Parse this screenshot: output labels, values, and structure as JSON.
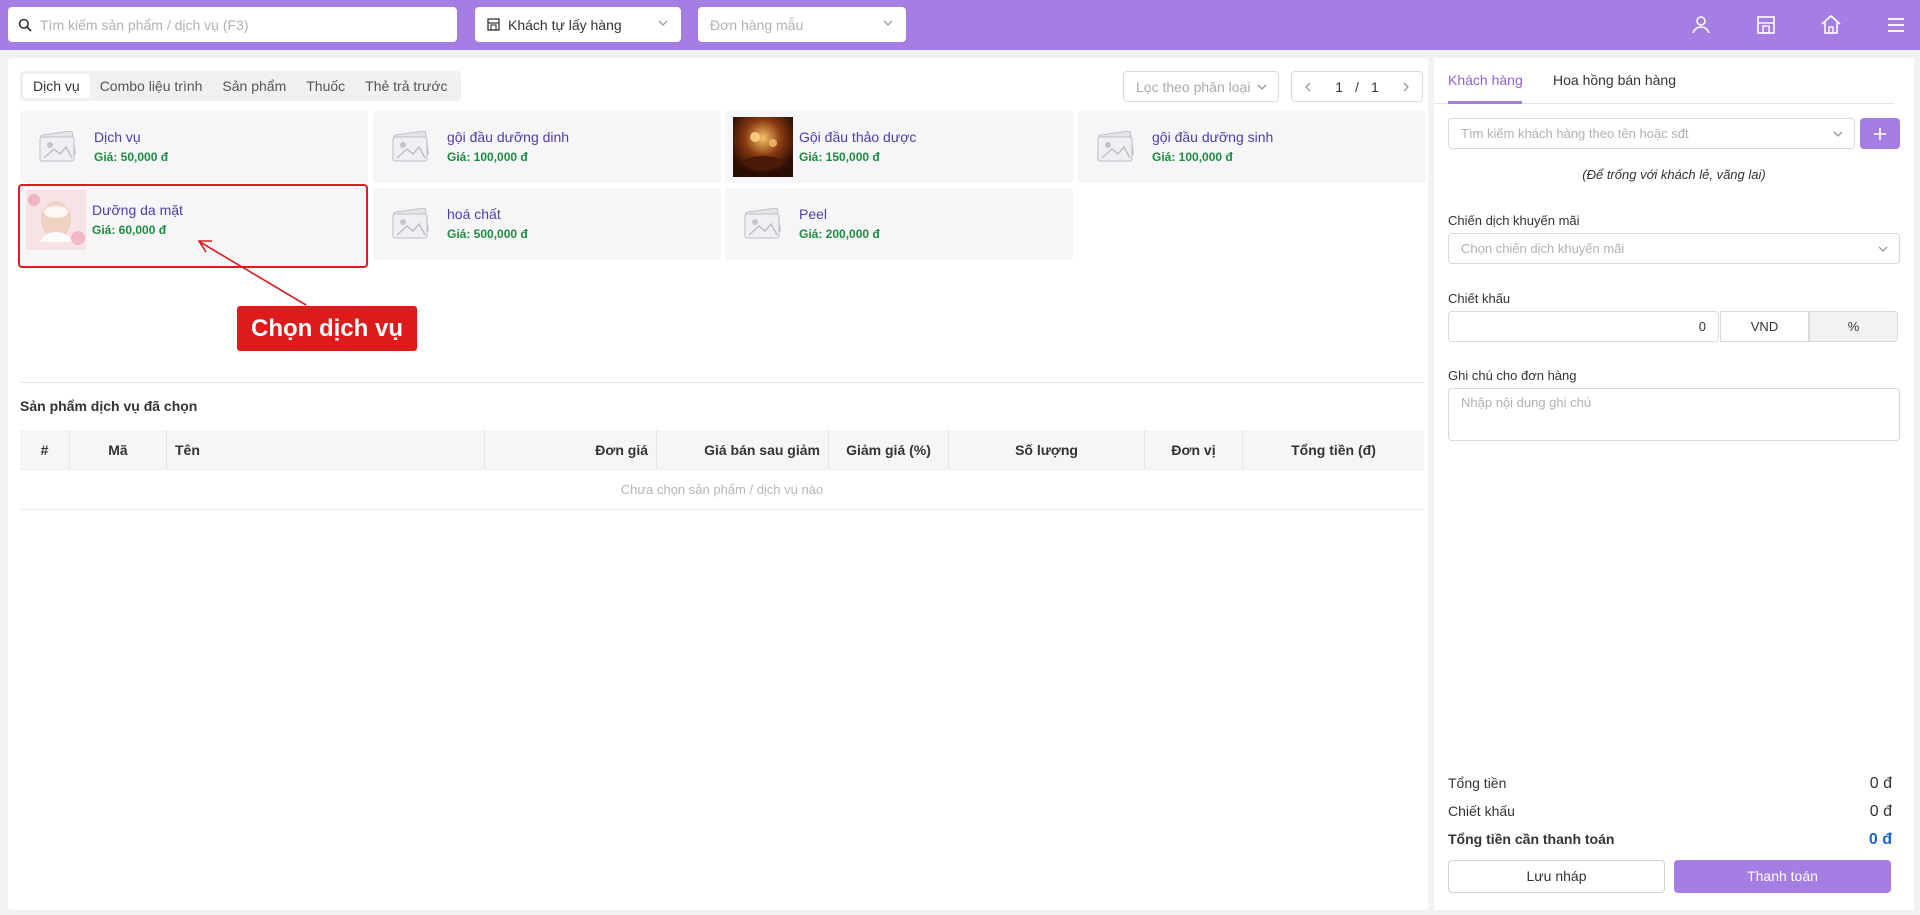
{
  "topbar": {
    "search_placeholder": "Tìm kiếm sản phẩm / dịch vụ (F3)",
    "delivery_mode": "Khách tự lấy hàng",
    "template_order_placeholder": "Đơn hàng mẫu",
    "icons": [
      "user-icon",
      "store-icon",
      "home-icon",
      "menu-icon"
    ],
    "color": "#a57ee3"
  },
  "catalog": {
    "tabs": [
      {
        "label": "Dịch vụ",
        "active": true
      },
      {
        "label": "Combo liệu trình"
      },
      {
        "label": "Sản phẩm"
      },
      {
        "label": "Thuốc"
      },
      {
        "label": "Thẻ trả trước"
      }
    ],
    "filter_placeholder": "Lọc theo phân loại",
    "pager": {
      "current": "1",
      "separator": "/",
      "total": "1"
    },
    "items": [
      {
        "name": "Dịch vụ",
        "price": "Giá: 50,000 đ",
        "image": "placeholder-image-icon"
      },
      {
        "name": "gội đầu dưỡng dinh",
        "price": "Giá: 100,000 đ",
        "image": "placeholder-image-icon"
      },
      {
        "name": "Gội đầu thảo dược",
        "price": "Giá: 150,000 đ",
        "image": "herbal-photo"
      },
      {
        "name": "gội đầu dưỡng sinh",
        "price": "Giá: 100,000 đ",
        "image": "placeholder-image-icon"
      },
      {
        "name": "Dưỡng da mặt",
        "price": "Giá: 60,000 đ",
        "image": "facial-photo",
        "selected": true
      },
      {
        "name": "hoá chất",
        "price": "Giá: 500,000 đ",
        "image": "placeholder-image-icon"
      },
      {
        "name": "Peel",
        "price": "Giá: 200,000 đ",
        "image": "placeholder-image-icon"
      }
    ],
    "callout": "Chọn dịch vụ"
  },
  "selected": {
    "title": "Sản phẩm dịch vụ đã chọn",
    "columns": [
      "#",
      "Mã",
      "Tên",
      "Đơn giá",
      "Giá bán sau giảm",
      "Giảm giá (%)",
      "Số lượng",
      "Đơn vị",
      "Tổng tiền (đ)"
    ],
    "empty": "Chưa chọn sản phẩm / dịch vụ nào"
  },
  "customer_panel": {
    "tabs": [
      "Khách hàng",
      "Hoa hồng bán hàng"
    ],
    "search_placeholder": "Tìm kiếm khách hàng theo tên hoặc sđt",
    "hint": "(Để trống với khách lẻ, vãng lai)",
    "promo_label": "Chiến dịch khuyến mãi",
    "promo_placeholder": "Chọn chiến dịch khuyến mãi",
    "discount_label": "Chiết khấu",
    "discount_value": "0",
    "unit_vnd": "VND",
    "unit_pct": "%",
    "note_label": "Ghi chú cho đơn hàng",
    "note_placeholder": "Nhập nội dung ghi chú",
    "summary": {
      "subtotal_label": "Tổng tiền",
      "subtotal": "0 đ",
      "discount_label": "Chiết khấu",
      "discount": "0 đ",
      "total_label": "Tổng tiền cần thanh toán",
      "total": "0 đ"
    },
    "draft_button": "Lưu nháp",
    "pay_button": "Thanh toán"
  }
}
